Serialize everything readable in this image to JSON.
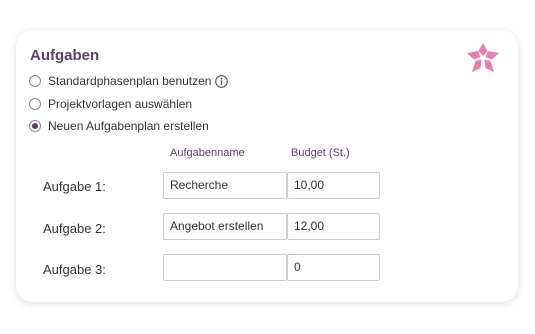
{
  "card": {
    "title": "Aufgaben"
  },
  "options": [
    {
      "label": "Standardphasenplan benutzen",
      "checked": false,
      "has_info_icon": true
    },
    {
      "label": "Projektvorlagen auswählen",
      "checked": false
    },
    {
      "label": "Neuen Aufgabenplan erstellen",
      "checked": true
    }
  ],
  "table": {
    "headers": {
      "name": "Aufgabenname",
      "budget": "Budget (St.)"
    },
    "rows": [
      {
        "label": "Aufgabe 1:",
        "name": "Recherche",
        "budget": "10,00"
      },
      {
        "label": "Aufgabe 2:",
        "name": "Angebot erstellen",
        "budget": "12,00"
      },
      {
        "label": "Aufgabe 3:",
        "name": "",
        "budget": "0"
      }
    ]
  },
  "colors": {
    "accent": "#5c3f6b",
    "logo": "#e67fb0"
  },
  "icons": {
    "info": "info-icon",
    "logo": "flower-logo-icon"
  }
}
